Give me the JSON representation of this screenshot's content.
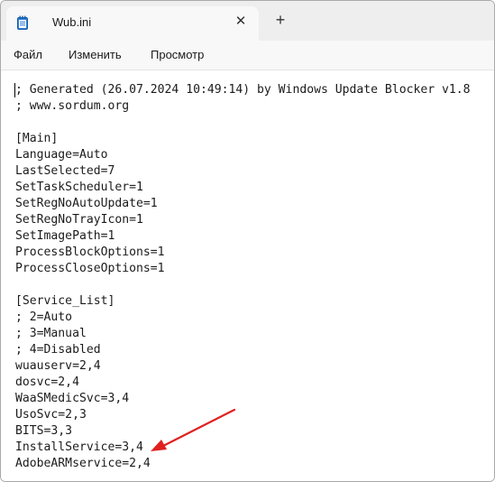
{
  "window": {
    "tab_title": "Wub.ini",
    "tab_close_glyph": "✕",
    "new_tab_glyph": "+"
  },
  "menu": {
    "file": "Файл",
    "edit": "Изменить",
    "view": "Просмотр"
  },
  "editor": {
    "lines": [
      "; Generated (26.07.2024 10:49:14) by Windows Update Blocker v1.8",
      "; www.sordum.org",
      "",
      "[Main]",
      "Language=Auto",
      "LastSelected=7",
      "SetTaskScheduler=1",
      "SetRegNoAutoUpdate=1",
      "SetRegNoTrayIcon=1",
      "SetImagePath=1",
      "ProcessBlockOptions=1",
      "ProcessCloseOptions=1",
      "",
      "[Service_List]",
      "; 2=Auto",
      "; 3=Manual",
      "; 4=Disabled",
      "wuauserv=2,4",
      "dosvc=2,4",
      "WaaSMedicSvc=3,4",
      "UsoSvc=2,3",
      "BITS=3,3",
      "InstallService=3,4",
      "AdobeARMservice=2,4"
    ]
  },
  "annotation": {
    "arrow_color": "#e02020",
    "points_to_line": "InstallService=3,4"
  },
  "colors": {
    "titlebar_bg": "#eeeeee",
    "tab_bg": "#f8f8f8",
    "text": "#1b1b1b",
    "icon_blue": "#2f7fd6"
  }
}
